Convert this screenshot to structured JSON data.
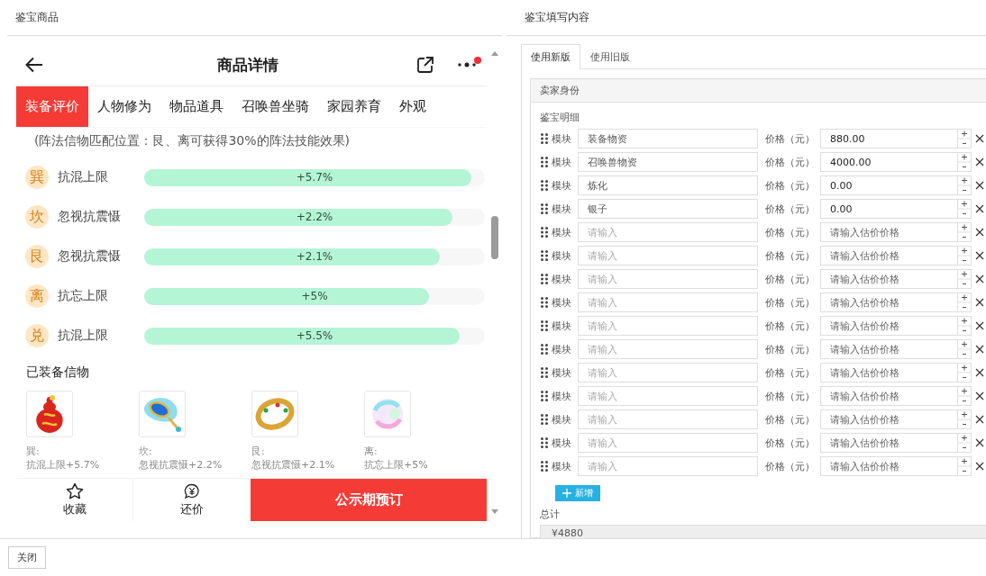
{
  "left_panel": {
    "title": "鉴宝商品"
  },
  "right_panel": {
    "title": "鉴宝填写内容"
  },
  "phone": {
    "title": "商品详情",
    "notification": true,
    "tabs": [
      {
        "label": "装备评价",
        "selected": true
      },
      {
        "label": "人物修为",
        "selected": false
      },
      {
        "label": "物品道具",
        "selected": false
      },
      {
        "label": "召唤兽坐骑",
        "selected": false
      },
      {
        "label": "家园养育",
        "selected": false
      },
      {
        "label": "外观",
        "selected": false
      }
    ],
    "note": "(阵法信物匹配位置：艮、离可获得30%的阵法技能效果)",
    "attributes": [
      {
        "position": "巽",
        "name": "抗混上限",
        "reading": "+5.7%",
        "level": 0.96
      },
      {
        "position": "坎",
        "name": "忽视抗震慑",
        "reading": "+2.2%",
        "level": 0.905
      },
      {
        "position": "艮",
        "name": "忽视抗震慑",
        "reading": "+2.1%",
        "level": 0.868
      },
      {
        "position": "离",
        "name": "抗忘上限",
        "reading": "+5%",
        "level": 0.836
      },
      {
        "position": "兑",
        "name": "抗混上限",
        "reading": "+5.5%",
        "level": 0.926
      }
    ],
    "equipped_title": "已装备信物",
    "equipped": [
      {
        "kind": "gourd",
        "position": "巽:",
        "effect": "抗混上限+5.7%"
      },
      {
        "kind": "mirror",
        "position": "坎:",
        "effect": "忽视抗震慑+2.2%"
      },
      {
        "kind": "ring",
        "position": "艮:",
        "effect": "忽视抗震慑+2.1%"
      },
      {
        "kind": "orb",
        "position": "离:",
        "effect": "抗忘上限+5%"
      }
    ],
    "actions": [
      {
        "kind": "star",
        "label": "收藏"
      },
      {
        "kind": "yen",
        "label": "还价"
      }
    ],
    "primary_action": "公示期预订"
  },
  "form": {
    "tabs": [
      {
        "label": "使用新版",
        "selected": true
      },
      {
        "label": "使用旧版",
        "selected": false
      }
    ],
    "seller_section": "卖家身份",
    "detail_label": "鉴宝明细",
    "rows": [
      {
        "module_label": "模块",
        "module": {
          "value": "装备物资"
        },
        "price_label": "价格（元）",
        "price": {
          "value": "880.00"
        }
      },
      {
        "module_label": "模块",
        "module": {
          "value": "召唤兽物资"
        },
        "price_label": "价格（元）",
        "price": {
          "value": "4000.00"
        }
      },
      {
        "module_label": "模块",
        "module": {
          "value": "炼化"
        },
        "price_label": "价格（元）",
        "price": {
          "value": "0.00"
        }
      },
      {
        "module_label": "模块",
        "module": {
          "value": "银子"
        },
        "price_label": "价格（元）",
        "price": {
          "value": "0.00"
        }
      },
      {
        "module_label": "模块",
        "module": {
          "placeholder": "请输入"
        },
        "price_label": "价格（元）",
        "price": {
          "placeholder": "请输入估价价格"
        }
      },
      {
        "module_label": "模块",
        "module": {
          "placeholder": "请输入"
        },
        "price_label": "价格（元）",
        "price": {
          "placeholder": "请输入估价价格"
        }
      },
      {
        "module_label": "模块",
        "module": {
          "placeholder": "请输入"
        },
        "price_label": "价格（元）",
        "price": {
          "placeholder": "请输入估价价格"
        }
      },
      {
        "module_label": "模块",
        "module": {
          "placeholder": "请输入"
        },
        "price_label": "价格（元）",
        "price": {
          "placeholder": "请输入估价价格"
        }
      },
      {
        "module_label": "模块",
        "module": {
          "placeholder": "请输入"
        },
        "price_label": "价格（元）",
        "price": {
          "placeholder": "请输入估价价格"
        }
      },
      {
        "module_label": "模块",
        "module": {
          "placeholder": "请输入"
        },
        "price_label": "价格（元）",
        "price": {
          "placeholder": "请输入估价价格"
        }
      },
      {
        "module_label": "模块",
        "module": {
          "placeholder": "请输入"
        },
        "price_label": "价格（元）",
        "price": {
          "placeholder": "请输入估价价格"
        }
      },
      {
        "module_label": "模块",
        "module": {
          "placeholder": "请输入"
        },
        "price_label": "价格（元）",
        "price": {
          "placeholder": "请输入估价价格"
        }
      },
      {
        "module_label": "模块",
        "module": {
          "placeholder": "请输入"
        },
        "price_label": "价格（元）",
        "price": {
          "placeholder": "请输入估价价格"
        }
      },
      {
        "module_label": "模块",
        "module": {
          "placeholder": "请输入"
        },
        "price_label": "价格（元）",
        "price": {
          "placeholder": "请输入估价价格"
        }
      },
      {
        "module_label": "模块",
        "module": {
          "placeholder": "请输入"
        },
        "price_label": "价格（元）",
        "price": {
          "placeholder": "请输入估价价格"
        }
      }
    ],
    "add_button": "新增",
    "total_label": "总计",
    "total": "¥4880"
  },
  "close_button": "关闭"
}
